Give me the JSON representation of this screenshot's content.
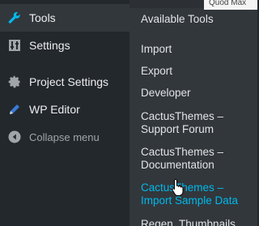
{
  "admin_menu": {
    "items": [
      {
        "label": "Tools",
        "icon": "wrench-icon",
        "active": true
      },
      {
        "label": "Settings",
        "icon": "settings-sliders-icon"
      },
      {
        "label": "Project Settings",
        "icon": "gear-icon"
      },
      {
        "label": "WP Editor",
        "icon": "pencil-icon"
      }
    ],
    "collapse_label": "Collapse menu",
    "collapse_icon": "collapse-arrow-icon"
  },
  "submenu": {
    "items": [
      {
        "label": "Available Tools"
      },
      {
        "label": "Import"
      },
      {
        "label": "Export"
      },
      {
        "label": "Developer"
      },
      {
        "label": "CactusThemes – Support Forum"
      },
      {
        "label": "CactusThemes – Documentation"
      },
      {
        "label": "CactusThemes – Import Sample Data",
        "hovered": true
      },
      {
        "label": "Regen. Thumbnails"
      }
    ]
  },
  "header_peek": {
    "text": "Quod Max"
  },
  "colors": {
    "menu_bg": "#23282d",
    "submenu_bg": "#32373c",
    "accent": "#00b9eb",
    "text": "#eeeeee"
  }
}
